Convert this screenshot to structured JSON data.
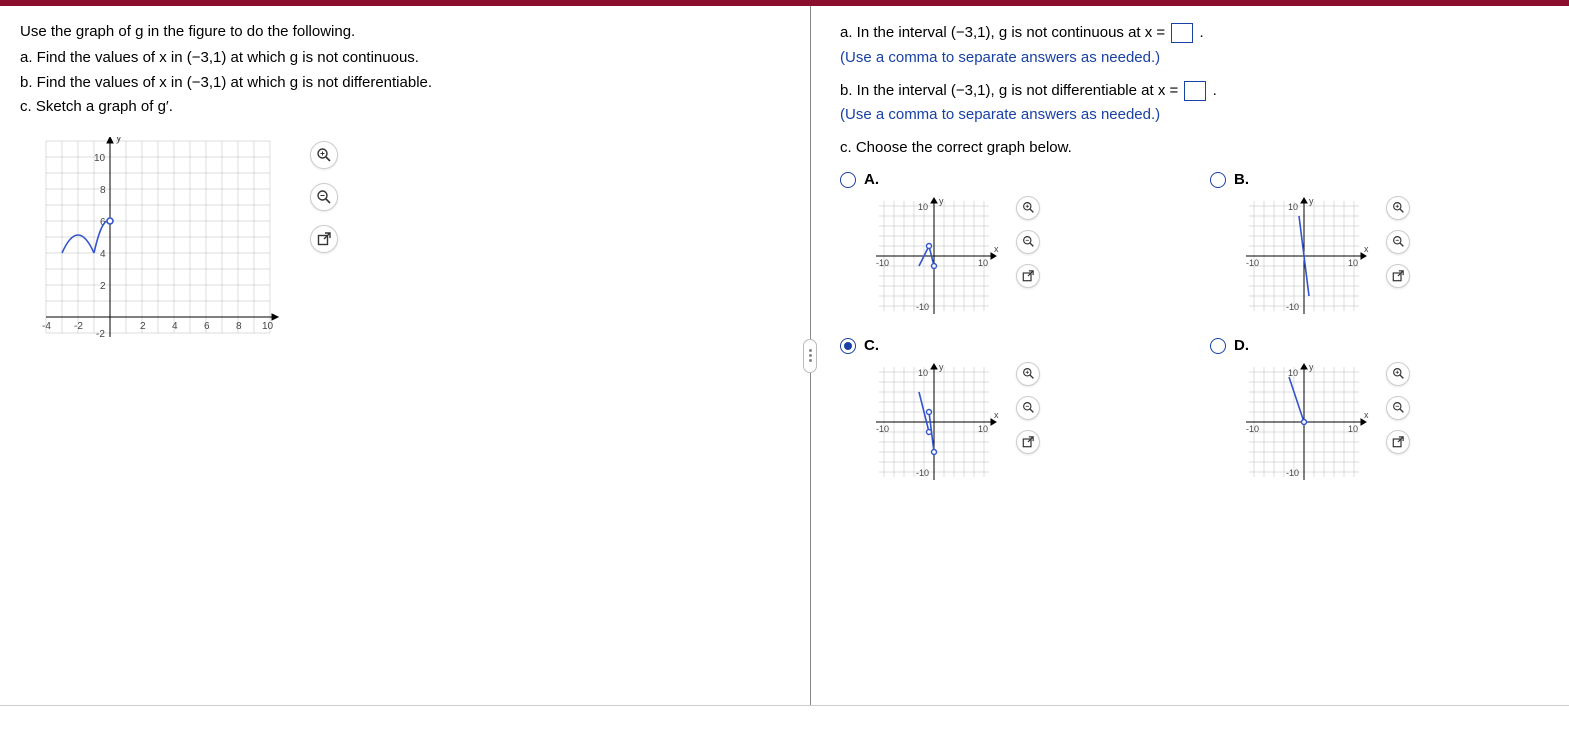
{
  "question": {
    "intro": "Use the graph of g in the figure to do the following.",
    "a": "a. Find the values of x in (−3,1) at which g is not continuous.",
    "b": "b. Find the values of x in (−3,1) at which g is not differentiable.",
    "c": "c. Sketch a graph of g′."
  },
  "answers": {
    "a_text1": "a. In the interval (−3,1), g is not continuous at x =",
    "a_text2": ".",
    "a_hint": "(Use a comma to separate answers as needed.)",
    "b_text1": "b. In the interval (−3,1), g is not differentiable at x =",
    "b_text2": ".",
    "b_hint": "(Use a comma to separate answers as needed.)",
    "c_text": "c. Choose the correct graph below."
  },
  "choices": {
    "A": "A.",
    "B": "B.",
    "C": "C.",
    "D": "D."
  },
  "selected_choice": "C",
  "main_graph": {
    "x_label": "x",
    "y_label": "y",
    "x_ticks": [
      -4,
      -2,
      2,
      4,
      6,
      8,
      10
    ],
    "y_ticks": [
      -2,
      2,
      4,
      6,
      8,
      10
    ]
  },
  "mini": {
    "x_label": "x",
    "y_label": "y",
    "x_ticks": [
      -10,
      10
    ],
    "y_ticks": [
      -10,
      10
    ]
  },
  "chart_data": [
    {
      "type": "line",
      "name": "main-graph-g",
      "xlabel": "x",
      "ylabel": "y",
      "xlim": [
        -4,
        10
      ],
      "ylim": [
        -2,
        10
      ],
      "annotations": [
        "open circle at (0,6)"
      ],
      "series": [
        {
          "name": "left-arc",
          "x": [
            -3,
            -2.5,
            -2,
            -1.5,
            -1
          ],
          "y": [
            4,
            5.6,
            6,
            5.6,
            4
          ]
        },
        {
          "name": "right-arc",
          "x": [
            -1,
            -0.5,
            0
          ],
          "y": [
            4,
            5.6,
            6
          ]
        }
      ]
    },
    {
      "type": "line",
      "name": "choice-A",
      "xlim": [
        -10,
        10
      ],
      "ylim": [
        -10,
        10
      ],
      "annotations": [
        "open circles at (-1,2) and (0,-2)"
      ],
      "series": [
        {
          "name": "seg1",
          "x": [
            -3,
            -1
          ],
          "y": [
            -2,
            2
          ]
        },
        {
          "name": "seg2",
          "x": [
            -1,
            0
          ],
          "y": [
            2,
            -2
          ]
        }
      ]
    },
    {
      "type": "line",
      "name": "choice-B",
      "xlim": [
        -10,
        10
      ],
      "ylim": [
        -10,
        10
      ],
      "series": [
        {
          "name": "seg1",
          "x": [
            -1,
            1
          ],
          "y": [
            8,
            -8
          ]
        }
      ]
    },
    {
      "type": "line",
      "name": "choice-C",
      "xlim": [
        -10,
        10
      ],
      "ylim": [
        -10,
        10
      ],
      "annotations": [
        "open circles at (-1,2),(-1,-2),(0,-6)"
      ],
      "series": [
        {
          "name": "seg1",
          "x": [
            -3,
            -1
          ],
          "y": [
            6,
            -2
          ]
        },
        {
          "name": "seg2",
          "x": [
            -1,
            0
          ],
          "y": [
            2,
            -6
          ]
        }
      ]
    },
    {
      "type": "line",
      "name": "choice-D",
      "xlim": [
        -10,
        10
      ],
      "ylim": [
        -10,
        10
      ],
      "annotations": [
        "open circle at (0,0)"
      ],
      "series": [
        {
          "name": "seg1",
          "x": [
            -3,
            0
          ],
          "y": [
            9,
            0
          ]
        }
      ]
    }
  ]
}
